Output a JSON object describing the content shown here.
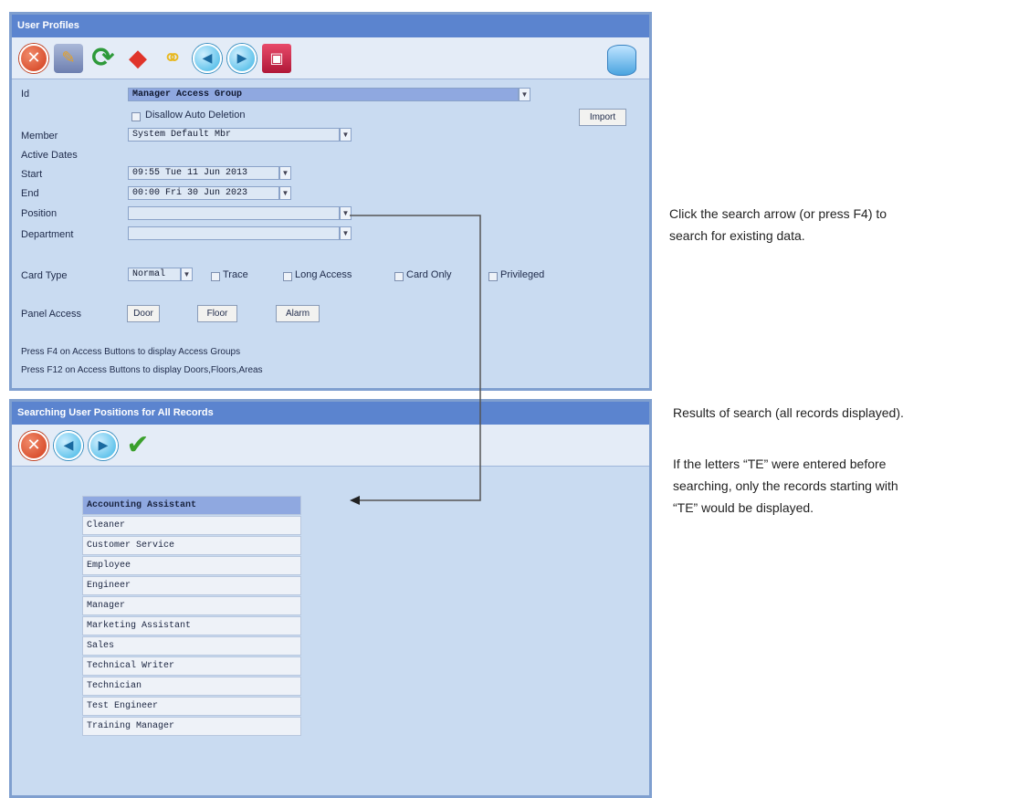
{
  "profiles": {
    "title": "User Profiles",
    "toolbar": [
      "cancel",
      "edit",
      "refresh",
      "erase",
      "link",
      "previous",
      "next",
      "save"
    ],
    "id_label": "Id",
    "id_value": "Manager Access Group",
    "disallow_label": "Disallow Auto Deletion",
    "import_label": "Import",
    "member_label": "Member",
    "member_value": "System Default Mbr",
    "active_dates_label": "Active Dates",
    "start_label": "Start",
    "start_value": "09:55 Tue 11 Jun 2013",
    "end_label": "End",
    "end_value": "00:00 Fri 30 Jun 2023",
    "position_label": "Position",
    "position_value": "",
    "department_label": "Department",
    "department_value": "",
    "card_type_label": "Card Type",
    "card_type_value": "Normal",
    "trace_label": "Trace",
    "long_access_label": "Long Access",
    "card_only_label": "Card Only",
    "privileged_label": "Privileged",
    "panel_access_label": "Panel Access",
    "door_label": "Door",
    "floor_label": "Floor",
    "alarm_label": "Alarm",
    "note1": "Press F4  on Access Buttons to display Access Groups",
    "note2": "Press F12 on Access Buttons to display Doors,Floors,Areas"
  },
  "search": {
    "title": "Searching User Positions for All Records",
    "items": [
      "Accounting Assistant",
      "Cleaner",
      "Customer Service",
      "Employee",
      "Engineer",
      "Manager",
      "Marketing Assistant",
      "Sales",
      "Technical Writer",
      "Technician",
      "Test Engineer",
      "Training Manager"
    ],
    "selected_index": 0
  },
  "callouts": {
    "search_line1": "Click the search arrow (or press F4) to",
    "search_line2": "search for existing data.",
    "results": "Results of search (all records displayed).",
    "te_line1": "If the letters “TE” were entered before",
    "te_line2": "searching, only the records starting with",
    "te_line3": "“TE” would be displayed."
  },
  "colors": {
    "title_bar": "#5b84cf",
    "panel_bg": "#c9dbf1",
    "selected_row": "#8fa8e0",
    "arrow": "#555555"
  }
}
